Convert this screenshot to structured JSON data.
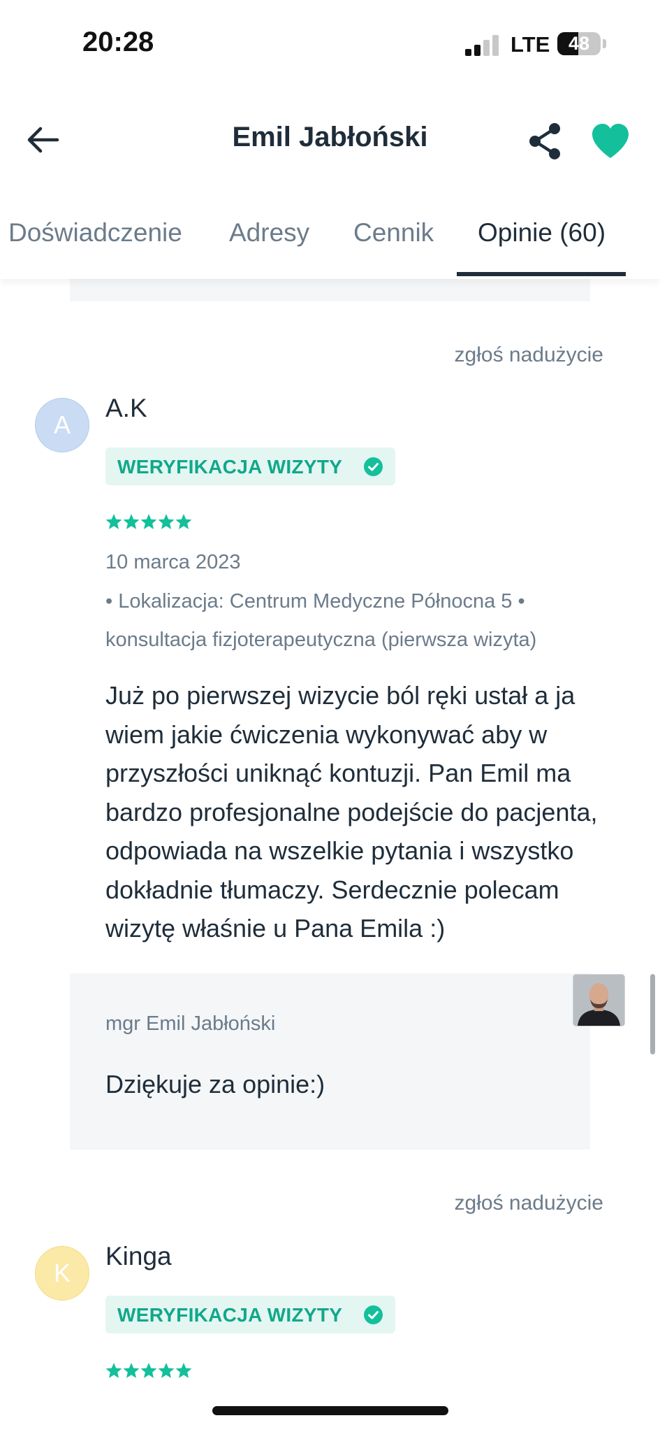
{
  "status_bar": {
    "time": "20:28",
    "network": "LTE",
    "battery": "48",
    "battery_level": 0.48
  },
  "header": {
    "title": "Emil Jabłoński"
  },
  "tabs": [
    {
      "label": "Doświadczenie"
    },
    {
      "label": "Adresy"
    },
    {
      "label": "Cennik"
    },
    {
      "label": "Opinie (60)"
    }
  ],
  "reviews": [
    {
      "report": "zgłoś nadużycie",
      "initial": "A",
      "author": "A.K",
      "badge": "WERYFIKACJA WIZYTY",
      "rating": 5,
      "date": "10 marca 2023",
      "meta": "• Lokalizacja: Centrum Medyczne Północna 5 • konsultacja fizjoterapeutyczna (pierwsza wizyta)",
      "text": "Już po pierwszej wizycie ból ręki ustał a ja wiem jakie ćwiczenia wykonywać aby w przyszłości uniknąć kontuzji. Pan Emil ma bardzo profesjonalne podejście do pacjenta, odpowiada na wszelkie pytania i wszystko dokładnie tłumaczy. Serdecznie polecam wizytę właśnie u Pana Emila :)",
      "reply": {
        "author": "mgr Emil Jabłoński",
        "text": "Dziękuje za opinie:)"
      }
    },
    {
      "report": "zgłoś nadużycie",
      "initial": "K",
      "author": "Kinga",
      "badge": "WERYFIKACJA WIZYTY",
      "rating": 5
    }
  ],
  "colors": {
    "accent": "#13c09b",
    "badge_bg": "#e3f6f2",
    "text_dark": "#1f2d3a",
    "text_muted": "#6b7b8a"
  }
}
